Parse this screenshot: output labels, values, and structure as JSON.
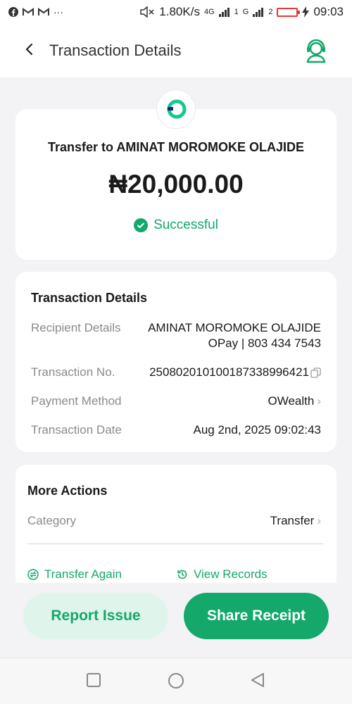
{
  "status_bar": {
    "net_speed": "1.80K/s",
    "net_4g": "4G",
    "net_g": "G",
    "sim1": "1",
    "sim2": "2",
    "time": "09:03",
    "dots": "···"
  },
  "header": {
    "title": "Transaction Details"
  },
  "hero": {
    "title": "Transfer to AMINAT MOROMOKE OLAJIDE",
    "amount": "₦20,000.00",
    "status": "Successful"
  },
  "details": {
    "title": "Transaction Details",
    "recipient_label": "Recipient Details",
    "recipient_name": "AMINAT MOROMOKE OLAJIDE",
    "recipient_account": "OPay | 803 434 7543",
    "txn_no_label": "Transaction No.",
    "txn_no_value": "250802010100187338996421",
    "payment_label": "Payment Method",
    "payment_value": "OWealth",
    "date_label": "Transaction Date",
    "date_value": "Aug 2nd, 2025 09:02:43"
  },
  "more_actions": {
    "title": "More Actions",
    "category_label": "Category",
    "category_value": "Transfer",
    "transfer_again": "Transfer Again",
    "view_records": "View Records"
  },
  "buttons": {
    "report_issue": "Report Issue",
    "share_receipt": "Share Receipt"
  },
  "colors": {
    "accent": "#14a86b",
    "accent_light": "#dff4ea",
    "background": "#f3f3f5"
  }
}
